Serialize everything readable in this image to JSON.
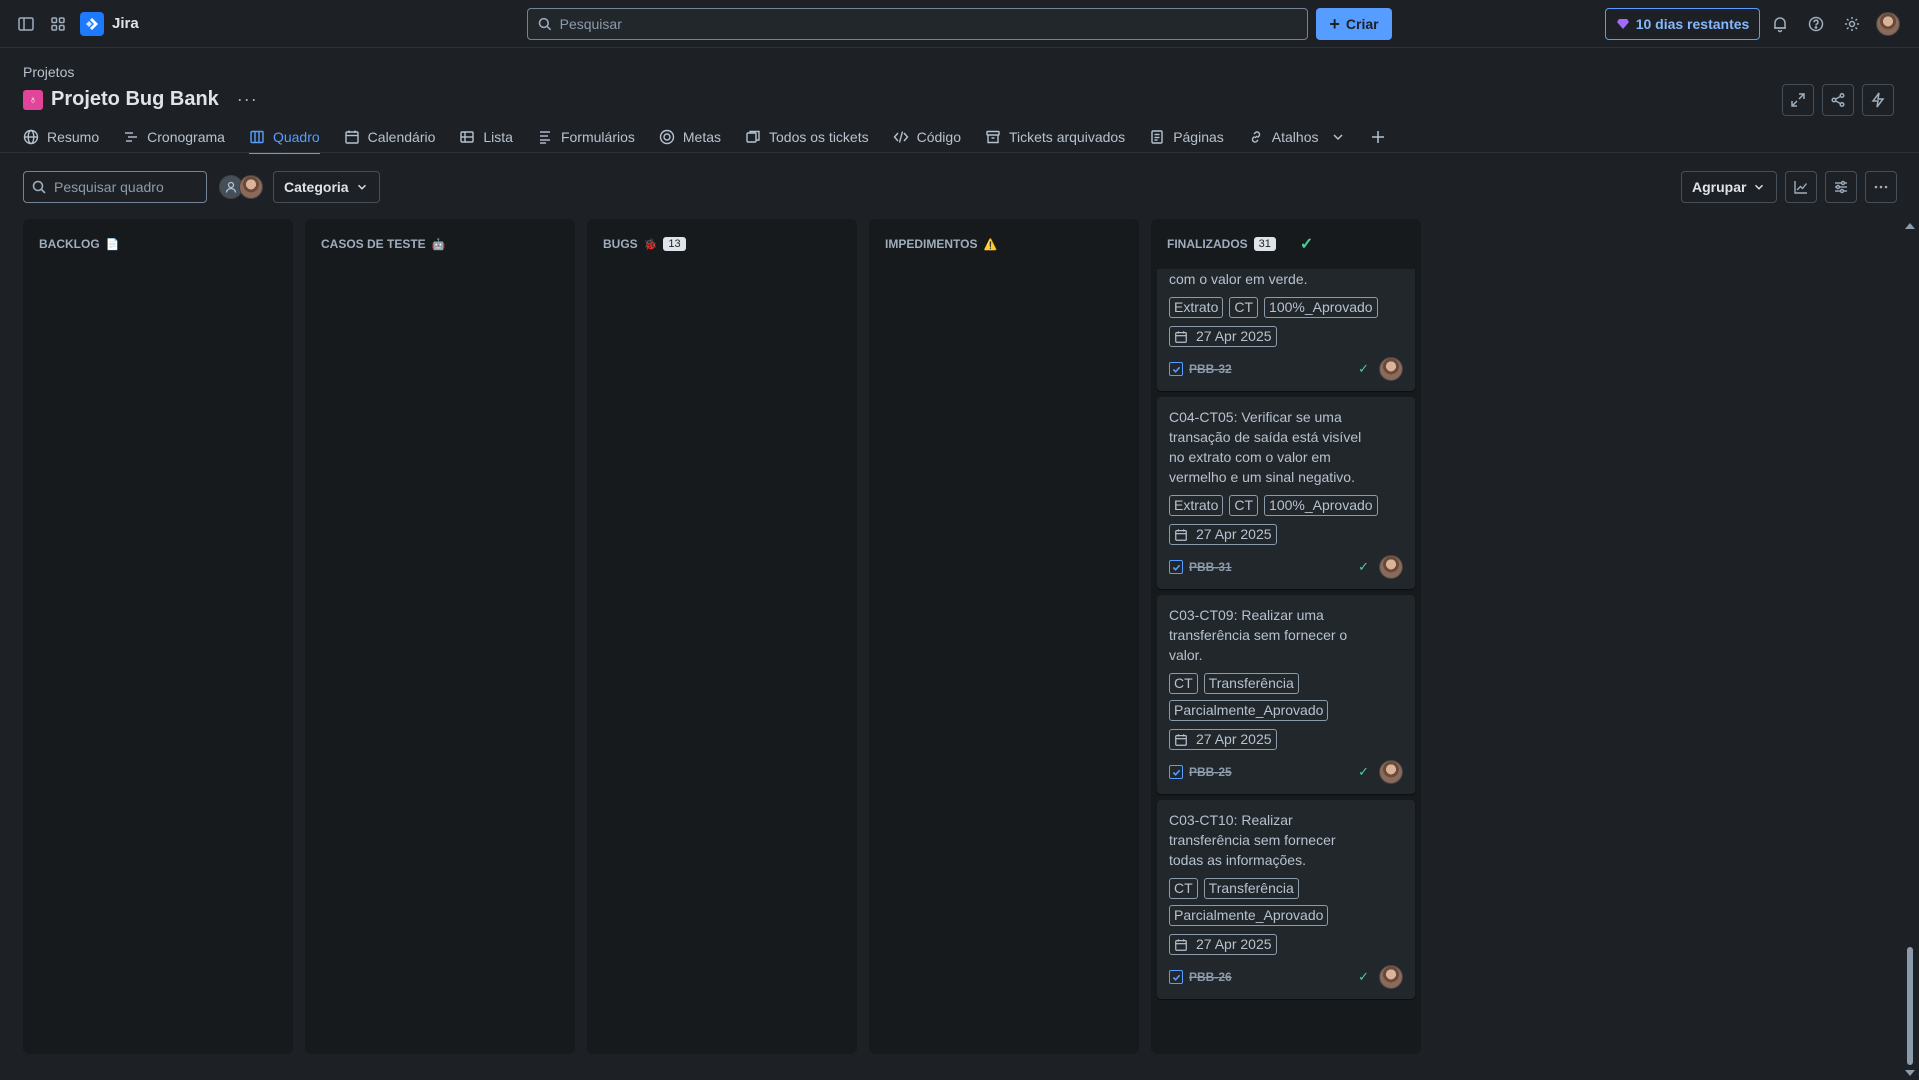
{
  "topbar": {
    "app_name": "Jira",
    "search_placeholder": "Pesquisar",
    "create_label": "Criar",
    "trial_label": "10 dias restantes"
  },
  "header": {
    "breadcrumb": "Projetos",
    "project_name": "Projeto Bug Bank",
    "more": "···"
  },
  "tabs": [
    {
      "label": "Resumo",
      "icon": "globe-icon"
    },
    {
      "label": "Cronograma",
      "icon": "timeline-icon"
    },
    {
      "label": "Quadro",
      "icon": "board-icon",
      "active": true
    },
    {
      "label": "Calendário",
      "icon": "calendar-icon"
    },
    {
      "label": "Lista",
      "icon": "list-icon"
    },
    {
      "label": "Formulários",
      "icon": "forms-icon"
    },
    {
      "label": "Metas",
      "icon": "goals-icon"
    },
    {
      "label": "Todos os tickets",
      "icon": "tickets-icon"
    },
    {
      "label": "Código",
      "icon": "code-icon"
    },
    {
      "label": "Tickets arquivados",
      "icon": "archive-icon"
    },
    {
      "label": "Páginas",
      "icon": "pages-icon"
    },
    {
      "label": "Atalhos",
      "icon": "link-icon"
    }
  ],
  "board_toolbar": {
    "search_placeholder": "Pesquisar quadro",
    "category_label": "Categoria",
    "group_label": "Agrupar"
  },
  "columns": [
    {
      "title": "BACKLOG",
      "emoji": "📄"
    },
    {
      "title": "CASOS DE TESTE",
      "emoji": "🤖"
    },
    {
      "title": "BUGS",
      "emoji": "🐞",
      "count": "13"
    },
    {
      "title": "IMPEDIMENTOS",
      "emoji": "⚠️"
    },
    {
      "title": "FINALIZADOS",
      "count": "31"
    }
  ],
  "cards": [
    {
      "title": "com o valor em verde.",
      "tags": [
        "Extrato",
        "CT",
        "100%_Aprovado"
      ],
      "date": "27 Apr 2025",
      "key": "PBB-32"
    },
    {
      "title": "C04-CT05: Verificar se uma transação de saída está visível no extrato com o valor em vermelho e um sinal negativo.",
      "tags": [
        "Extrato",
        "CT",
        "100%_Aprovado"
      ],
      "date": "27 Apr 2025",
      "key": "PBB-31"
    },
    {
      "title": "C03-CT09: Realizar uma transferência sem fornecer o valor.",
      "tags": [
        "CT",
        "Transferência",
        "Parcialmente_Aprovado"
      ],
      "date": "27 Apr 2025",
      "key": "PBB-25"
    },
    {
      "title": "C03-CT10: Realizar transferência sem fornecer todas as informações.",
      "tags": [
        "CT",
        "Transferência",
        "Parcialmente_Aprovado"
      ],
      "date": "27 Apr 2025",
      "key": "PBB-26"
    }
  ],
  "colors": {
    "accent": "#579dff",
    "project_icon": "#e2449a",
    "done": "#4bce97"
  }
}
